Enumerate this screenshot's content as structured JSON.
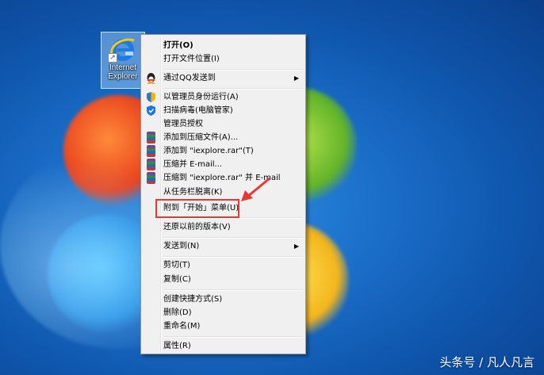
{
  "desktop": {
    "icon_label": "Internet\nExplorer"
  },
  "menu": {
    "items": [
      {
        "label": "打开(O)"
      },
      {
        "label": "打开文件位置(I)"
      },
      {
        "label": "通过QQ发送到"
      },
      {
        "label": "以管理员身份运行(A)"
      },
      {
        "label": "扫描病毒(电脑管家)"
      },
      {
        "label": "管理员授权"
      },
      {
        "label": "添加到压缩文件(A)..."
      },
      {
        "label": "添加到 \"iexplore.rar\"(T)"
      },
      {
        "label": "压缩并 E-mail..."
      },
      {
        "label": "压缩到 \"iexplore.rar\" 并 E-mail"
      },
      {
        "label": "从任务栏脱离(K)"
      },
      {
        "label": "附到「开始」菜单(U)"
      },
      {
        "label": "还原以前的版本(V)"
      },
      {
        "label": "发送到(N)"
      },
      {
        "label": "剪切(T)"
      },
      {
        "label": "复制(C)"
      },
      {
        "label": "创建快捷方式(S)"
      },
      {
        "label": "删除(D)"
      },
      {
        "label": "重命名(M)"
      },
      {
        "label": "属性(R)"
      }
    ]
  },
  "watermark": "头条号 / 凡人凡言",
  "colors": {
    "highlight": "#e53935",
    "desktop_bg": "#1b6fc9"
  }
}
